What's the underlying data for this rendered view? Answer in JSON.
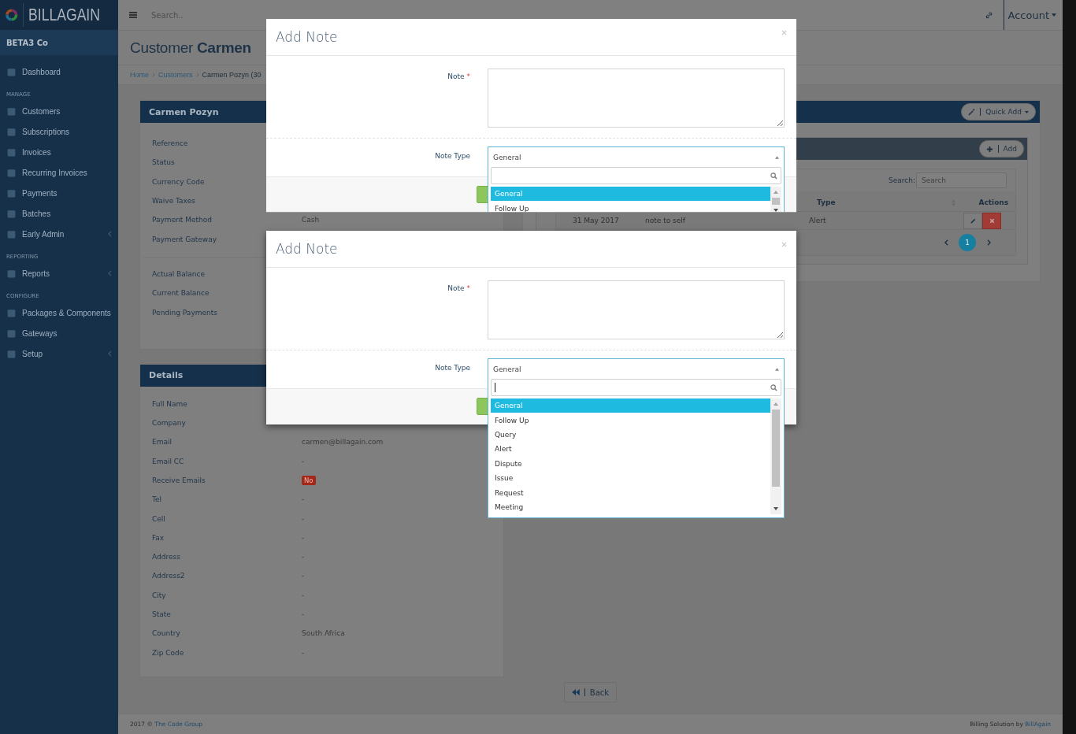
{
  "brand": {
    "name": "BILLAGAIN"
  },
  "topbar": {
    "search_placeholder": "Search..",
    "account": "Account"
  },
  "sidebar": {
    "company": "BETA3 Co",
    "sections": [
      {
        "items": [
          {
            "label": "Dashboard",
            "expandable": false
          }
        ]
      },
      {
        "heading": "MANAGE",
        "items": [
          {
            "label": "Customers",
            "expandable": false
          },
          {
            "label": "Subscriptions",
            "expandable": false
          },
          {
            "label": "Invoices",
            "expandable": false
          },
          {
            "label": "Recurring Invoices",
            "expandable": false
          },
          {
            "label": "Payments",
            "expandable": false
          },
          {
            "label": "Batches",
            "expandable": false
          },
          {
            "label": "Early Admin",
            "expandable": true
          }
        ]
      },
      {
        "heading": "REPORTING",
        "items": [
          {
            "label": "Reports",
            "expandable": true
          }
        ]
      },
      {
        "heading": "CONFIGURE",
        "items": [
          {
            "label": "Packages & Components",
            "expandable": false
          },
          {
            "label": "Gateways",
            "expandable": false
          },
          {
            "label": "Setup",
            "expandable": true
          }
        ]
      }
    ]
  },
  "page": {
    "title_light": "Customer",
    "title_bold": "Carmen"
  },
  "breadcrumb": [
    {
      "label": "Home",
      "kind": "link"
    },
    {
      "label": "Customers",
      "kind": "link"
    },
    {
      "label": "Carmen Pozyn (30",
      "kind": "current"
    }
  ],
  "customer_panel": {
    "title": "Carmen Pozyn",
    "groups": [
      [
        {
          "label": "Reference"
        },
        {
          "label": "Status"
        },
        {
          "label": "Currency Code"
        },
        {
          "label": "Waive Taxes"
        },
        {
          "label": "Payment Method",
          "value": "Cash",
          "kind": "text"
        },
        {
          "label": "Payment Gateway"
        }
      ],
      [
        {
          "label": "Actual Balance"
        },
        {
          "label": "Current Balance"
        },
        {
          "label": "Pending Payments"
        }
      ]
    ]
  },
  "details_panel": {
    "title": "Details",
    "rows": [
      {
        "label": "Full Name"
      },
      {
        "label": "Company"
      },
      {
        "label": "Email",
        "value": "carmen@billagain.com",
        "kind": "text"
      },
      {
        "label": "Email CC",
        "value": "-",
        "kind": "text"
      },
      {
        "label": "Receive Emails",
        "value": "No",
        "kind": "badge"
      },
      {
        "label": "Tel",
        "value": "-",
        "kind": "text"
      },
      {
        "label": "Cell",
        "value": "-",
        "kind": "text"
      },
      {
        "label": "Fax",
        "value": "-",
        "kind": "text"
      },
      {
        "label": "Address",
        "value": "-",
        "kind": "text"
      },
      {
        "label": "Address2",
        "value": "-",
        "kind": "text"
      },
      {
        "label": "City",
        "value": "-",
        "kind": "text"
      },
      {
        "label": "State",
        "value": "-",
        "kind": "text"
      },
      {
        "label": "Country",
        "value": "South Africa",
        "kind": "text"
      },
      {
        "label": "Zip Code",
        "value": "-",
        "kind": "text"
      }
    ]
  },
  "notes_panel": {
    "quick_add": "Quick Add",
    "add": "Add",
    "search_label": "Search:",
    "search_placeholder": "Search",
    "columns": [
      {
        "label": "Type"
      },
      {
        "label": "Actions"
      }
    ],
    "rows": [
      {
        "date": "31 May 2017",
        "note": "note to self",
        "type": "Alert"
      }
    ],
    "pages": [
      {
        "label": "1",
        "selected": true
      }
    ]
  },
  "back_button": "Back",
  "footer": {
    "year": "2017 ©",
    "company": "The Code Group",
    "credit": "Billing Solution by",
    "brand": "BillAgain"
  },
  "modals": [
    {
      "title": "Add Note",
      "note_label": "Note",
      "required_mark": "*",
      "note_type_label": "Note Type",
      "select_value": "General",
      "clipped": true,
      "options": [
        {
          "label": "General",
          "selected": true
        },
        {
          "label": "Follow Up",
          "selected": false
        }
      ]
    },
    {
      "title": "Add Note",
      "note_label": "Note",
      "required_mark": "*",
      "note_type_label": "Note Type",
      "select_value": "General",
      "clipped": false,
      "options": [
        {
          "label": "General",
          "selected": true
        },
        {
          "label": "Follow Up",
          "selected": false
        },
        {
          "label": "Query",
          "selected": false
        },
        {
          "label": "Alert",
          "selected": false
        },
        {
          "label": "Dispute",
          "selected": false
        },
        {
          "label": "Issue",
          "selected": false
        },
        {
          "label": "Request",
          "selected": false
        },
        {
          "label": "Meeting",
          "selected": false
        }
      ]
    }
  ]
}
